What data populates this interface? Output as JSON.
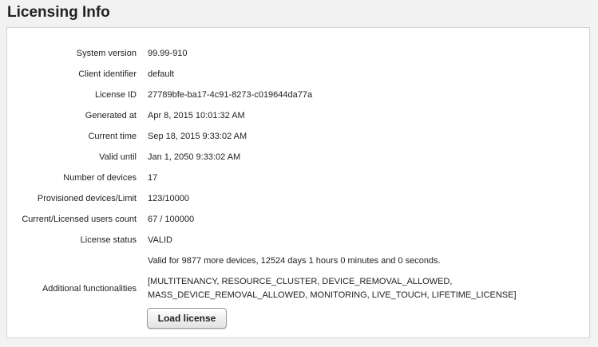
{
  "page": {
    "title": "Licensing Info"
  },
  "info": {
    "rows": [
      {
        "label": "System version",
        "value": "99.99-910"
      },
      {
        "label": "Client identifier",
        "value": "default"
      },
      {
        "label": "License ID",
        "value": "27789bfe-ba17-4c91-8273-c019644da77a"
      },
      {
        "label": "Generated at",
        "value": "Apr 8, 2015 10:01:32 AM"
      },
      {
        "label": "Current time",
        "value": "Sep 18, 2015 9:33:02 AM"
      },
      {
        "label": "Valid until",
        "value": "Jan 1, 2050 9:33:02 AM"
      },
      {
        "label": "Number of devices",
        "value": "17"
      },
      {
        "label": "Provisioned devices/Limit",
        "value": "123/10000"
      },
      {
        "label": "Current/Licensed users count",
        "value": "67 / 100000"
      },
      {
        "label": "License status",
        "value": "VALID"
      }
    ],
    "validity_note": "Valid for 9877 more devices, 12524 days 1 hours 0 minutes and 0 seconds.",
    "additional_label": "Additional functionalities",
    "additional_value": "[MULTITENANCY, RESOURCE_CLUSTER, DEVICE_REMOVAL_ALLOWED, MASS_DEVICE_REMOVAL_ALLOWED, MONITORING, LIVE_TOUCH, LIFETIME_LICENSE]"
  },
  "actions": {
    "load_license_label": "Load license"
  }
}
